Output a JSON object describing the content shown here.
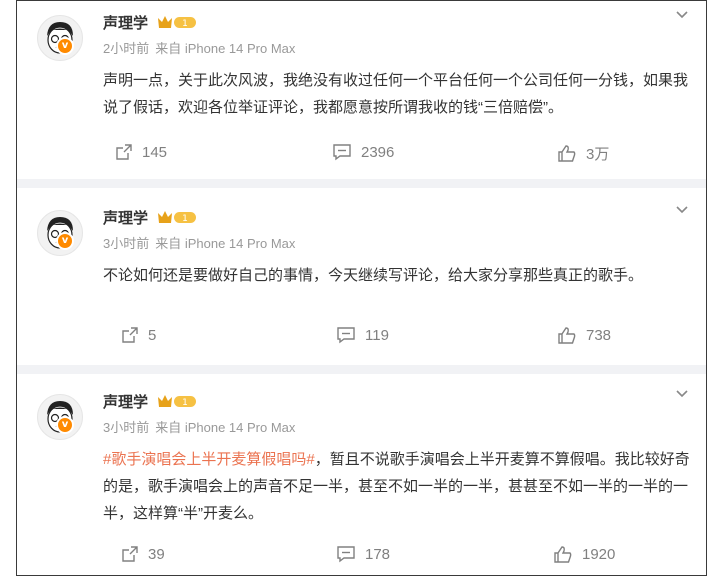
{
  "posts": [
    {
      "author": "声理学",
      "level_badge": "1",
      "time": "2小时前",
      "source": "来自 iPhone 14 Pro Max",
      "text": "声明一点，关于此次风波，我绝没有收过任何一个平台任何一个公司任何一分钱，如果我说了假话，欢迎各位举证评论，我都愿意按所谓我收的钱“三倍赔偿”。",
      "topic": "",
      "reposts": "145",
      "comments": "2396",
      "likes": "3万"
    },
    {
      "author": "声理学",
      "level_badge": "1",
      "time": "3小时前",
      "source": "来自 iPhone 14 Pro Max",
      "text": "不论如何还是要做好自己的事情，今天继续写评论，给大家分享那些真正的歌手。",
      "topic": "",
      "reposts": "5",
      "comments": "119",
      "likes": "738"
    },
    {
      "author": "声理学",
      "level_badge": "1",
      "time": "3小时前",
      "source": "来自 iPhone 14 Pro Max",
      "topic": "#歌手演唱会上半开麦算假唱吗#",
      "text": "，暂且不说歌手演唱会上半开麦算不算假唱。我比较好奇的是，歌手演唱会上的声音不足一半，甚至不如一半的一半，甚甚至不如一半的一半的一半，这样算“半”开麦么。",
      "reposts": "39",
      "comments": "178",
      "likes": "1920"
    }
  ],
  "icons": {
    "repost": "repost-icon",
    "comment": "comment-icon",
    "like": "thumbs-up-icon",
    "menu": "chevron-down-icon",
    "verified": "verified-v-icon",
    "level": "crown-level-icon"
  },
  "colors": {
    "topic": "#eb7350",
    "meta": "#999999",
    "verified": "#ff8a00",
    "divider": "#f1f2f5"
  }
}
